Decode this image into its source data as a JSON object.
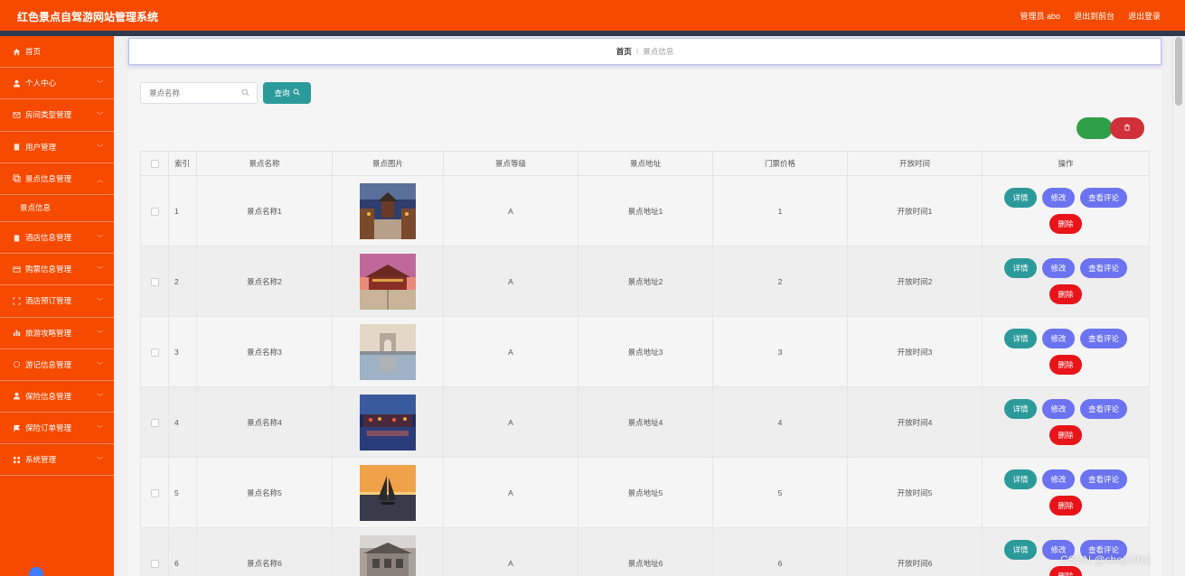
{
  "header": {
    "app_title": "红色景点自驾游网站管理系统",
    "admin_label": "管理员 abo",
    "to_front_label": "退出到前台",
    "logout_label": "退出登录",
    "bar_color": "#f54a00"
  },
  "sidebar": {
    "items": [
      {
        "label": "首页",
        "icon": "home-icon",
        "has_chevron": false
      },
      {
        "label": "个人中心",
        "icon": "user-icon",
        "has_chevron": true
      },
      {
        "label": "房间类型管理",
        "icon": "mail-icon",
        "has_chevron": true
      },
      {
        "label": "用户管理",
        "icon": "clipboard-icon",
        "has_chevron": true
      },
      {
        "label": "景点信息管理",
        "icon": "copy-icon",
        "has_chevron": true,
        "expanded": true
      },
      {
        "label": "酒店信息管理",
        "icon": "clipboard-icon",
        "has_chevron": true
      },
      {
        "label": "购票信息管理",
        "icon": "card-icon",
        "has_chevron": true
      },
      {
        "label": "酒店预订管理",
        "icon": "expand-icon",
        "has_chevron": true
      },
      {
        "label": "旅游攻略管理",
        "icon": "bar-chart-icon",
        "has_chevron": true
      },
      {
        "label": "游记信息管理",
        "icon": "sun-icon",
        "has_chevron": true
      },
      {
        "label": "保险信息管理",
        "icon": "user-icon",
        "has_chevron": true
      },
      {
        "label": "保险订单管理",
        "icon": "flag-icon",
        "has_chevron": true
      },
      {
        "label": "系统管理",
        "icon": "grid-icon",
        "has_chevron": true
      }
    ],
    "sub_item": "景点信息"
  },
  "breadcrumb": {
    "home": "首页",
    "separator": "/",
    "current": "景点信息"
  },
  "search": {
    "placeholder": "景点名称",
    "button_label": "查询"
  },
  "table": {
    "headers": [
      "索引",
      "景点名称",
      "景点图片",
      "景点等级",
      "景点地址",
      "门票价格",
      "开放时间",
      "操作"
    ],
    "rows": [
      {
        "index": "1",
        "name": "景点名称1",
        "image": "ancient-street-photo",
        "level": "A",
        "address": "景点地址1",
        "price": "1",
        "open_time": "开放时间1"
      },
      {
        "index": "2",
        "name": "景点名称2",
        "image": "palace-gate-photo",
        "level": "A",
        "address": "景点地址2",
        "price": "2",
        "open_time": "开放时间2"
      },
      {
        "index": "3",
        "name": "景点名称3",
        "image": "arch-reflection-photo",
        "level": "A",
        "address": "景点地址3",
        "price": "3",
        "open_time": "开放时间3"
      },
      {
        "index": "4",
        "name": "景点名称4",
        "image": "night-water-town-photo",
        "level": "A",
        "address": "景点地址4",
        "price": "4",
        "open_time": "开放时间4"
      },
      {
        "index": "5",
        "name": "景点名称5",
        "image": "sailboat-sunset-photo",
        "level": "A",
        "address": "景点地址5",
        "price": "5",
        "open_time": "开放时间5"
      },
      {
        "index": "6",
        "name": "景点名称6",
        "image": "old-building-photo",
        "level": "A",
        "address": "景点地址6",
        "price": "6",
        "open_time": "开放时间6"
      }
    ],
    "actions": {
      "detail": "详情",
      "edit": "修改",
      "comments": "查看评论",
      "delete": "删除"
    }
  },
  "colors": {
    "teal": "#2c9a9a",
    "purple": "#6b73f0",
    "red": "#e8141a",
    "green": "#2fa047"
  },
  "watermark": "CSDN @sheji1011"
}
